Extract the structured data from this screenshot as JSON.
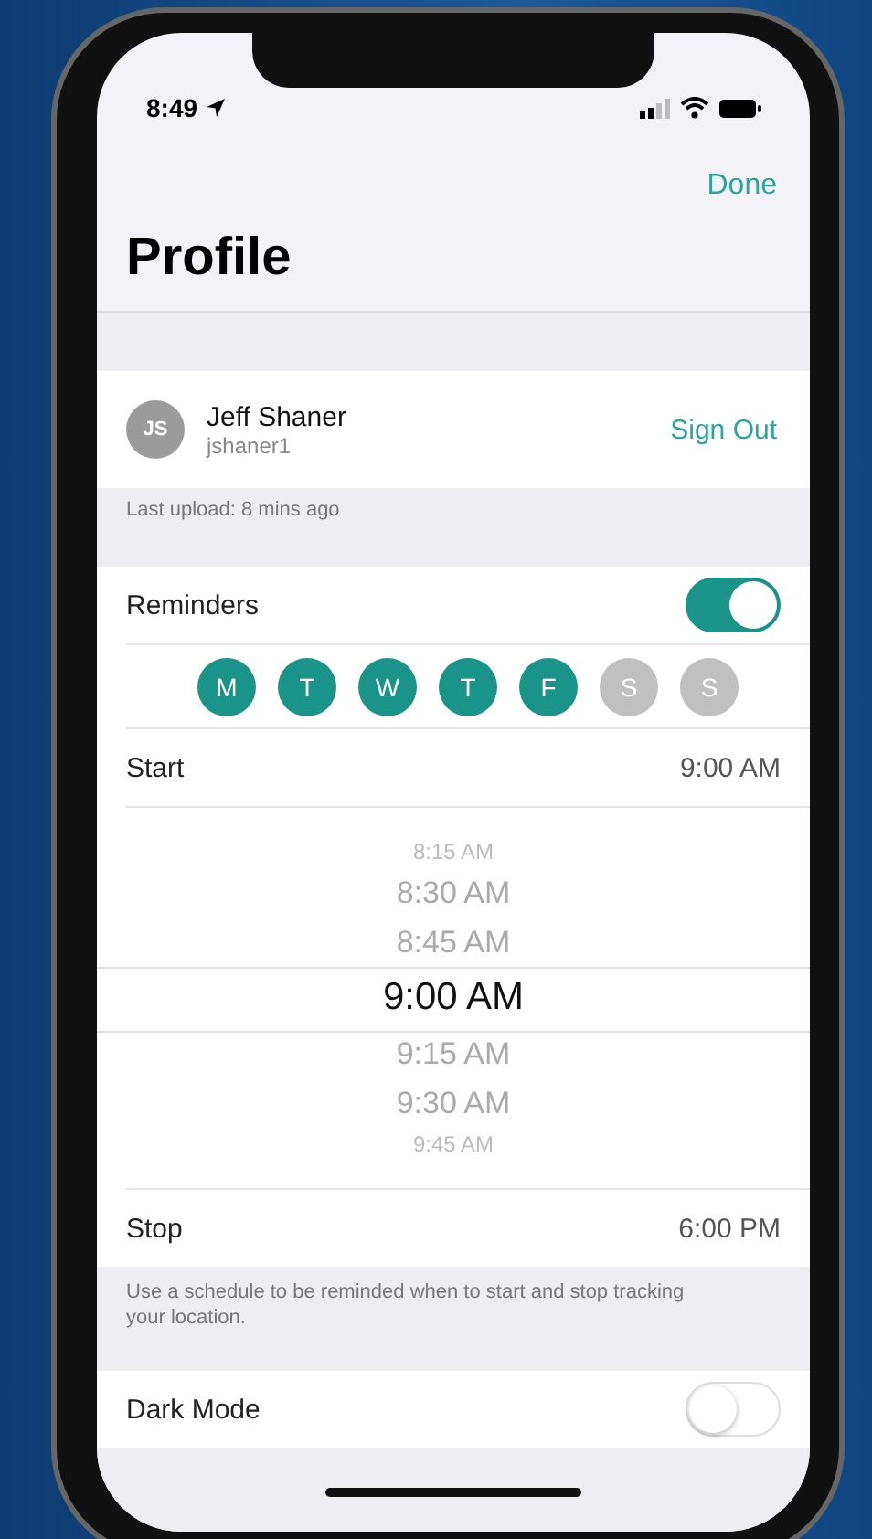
{
  "status_bar": {
    "time": "8:49"
  },
  "nav": {
    "done": "Done",
    "title": "Profile"
  },
  "account": {
    "initials": "JS",
    "name": "Jeff Shaner",
    "username": "jshaner1",
    "sign_out": "Sign Out"
  },
  "last_upload": "Last upload:  8 mins ago",
  "reminders": {
    "label": "Reminders",
    "on": true
  },
  "days": [
    {
      "letter": "M",
      "selected": true
    },
    {
      "letter": "T",
      "selected": true
    },
    {
      "letter": "W",
      "selected": true
    },
    {
      "letter": "T",
      "selected": true
    },
    {
      "letter": "F",
      "selected": true
    },
    {
      "letter": "S",
      "selected": false
    },
    {
      "letter": "S",
      "selected": false
    }
  ],
  "start": {
    "label": "Start",
    "value": "9:00 AM"
  },
  "picker": [
    {
      "label": "8:15 AM",
      "selected": false
    },
    {
      "label": "8:30 AM",
      "selected": false
    },
    {
      "label": "8:45 AM",
      "selected": false
    },
    {
      "label": "9:00 AM",
      "selected": true
    },
    {
      "label": "9:15 AM",
      "selected": false
    },
    {
      "label": "9:30 AM",
      "selected": false
    },
    {
      "label": "9:45 AM",
      "selected": false
    }
  ],
  "stop": {
    "label": "Stop",
    "value": "6:00 PM"
  },
  "note": "Use a schedule to be reminded when to start and stop tracking your location.",
  "dark_mode": {
    "label": "Dark Mode",
    "on": false
  }
}
